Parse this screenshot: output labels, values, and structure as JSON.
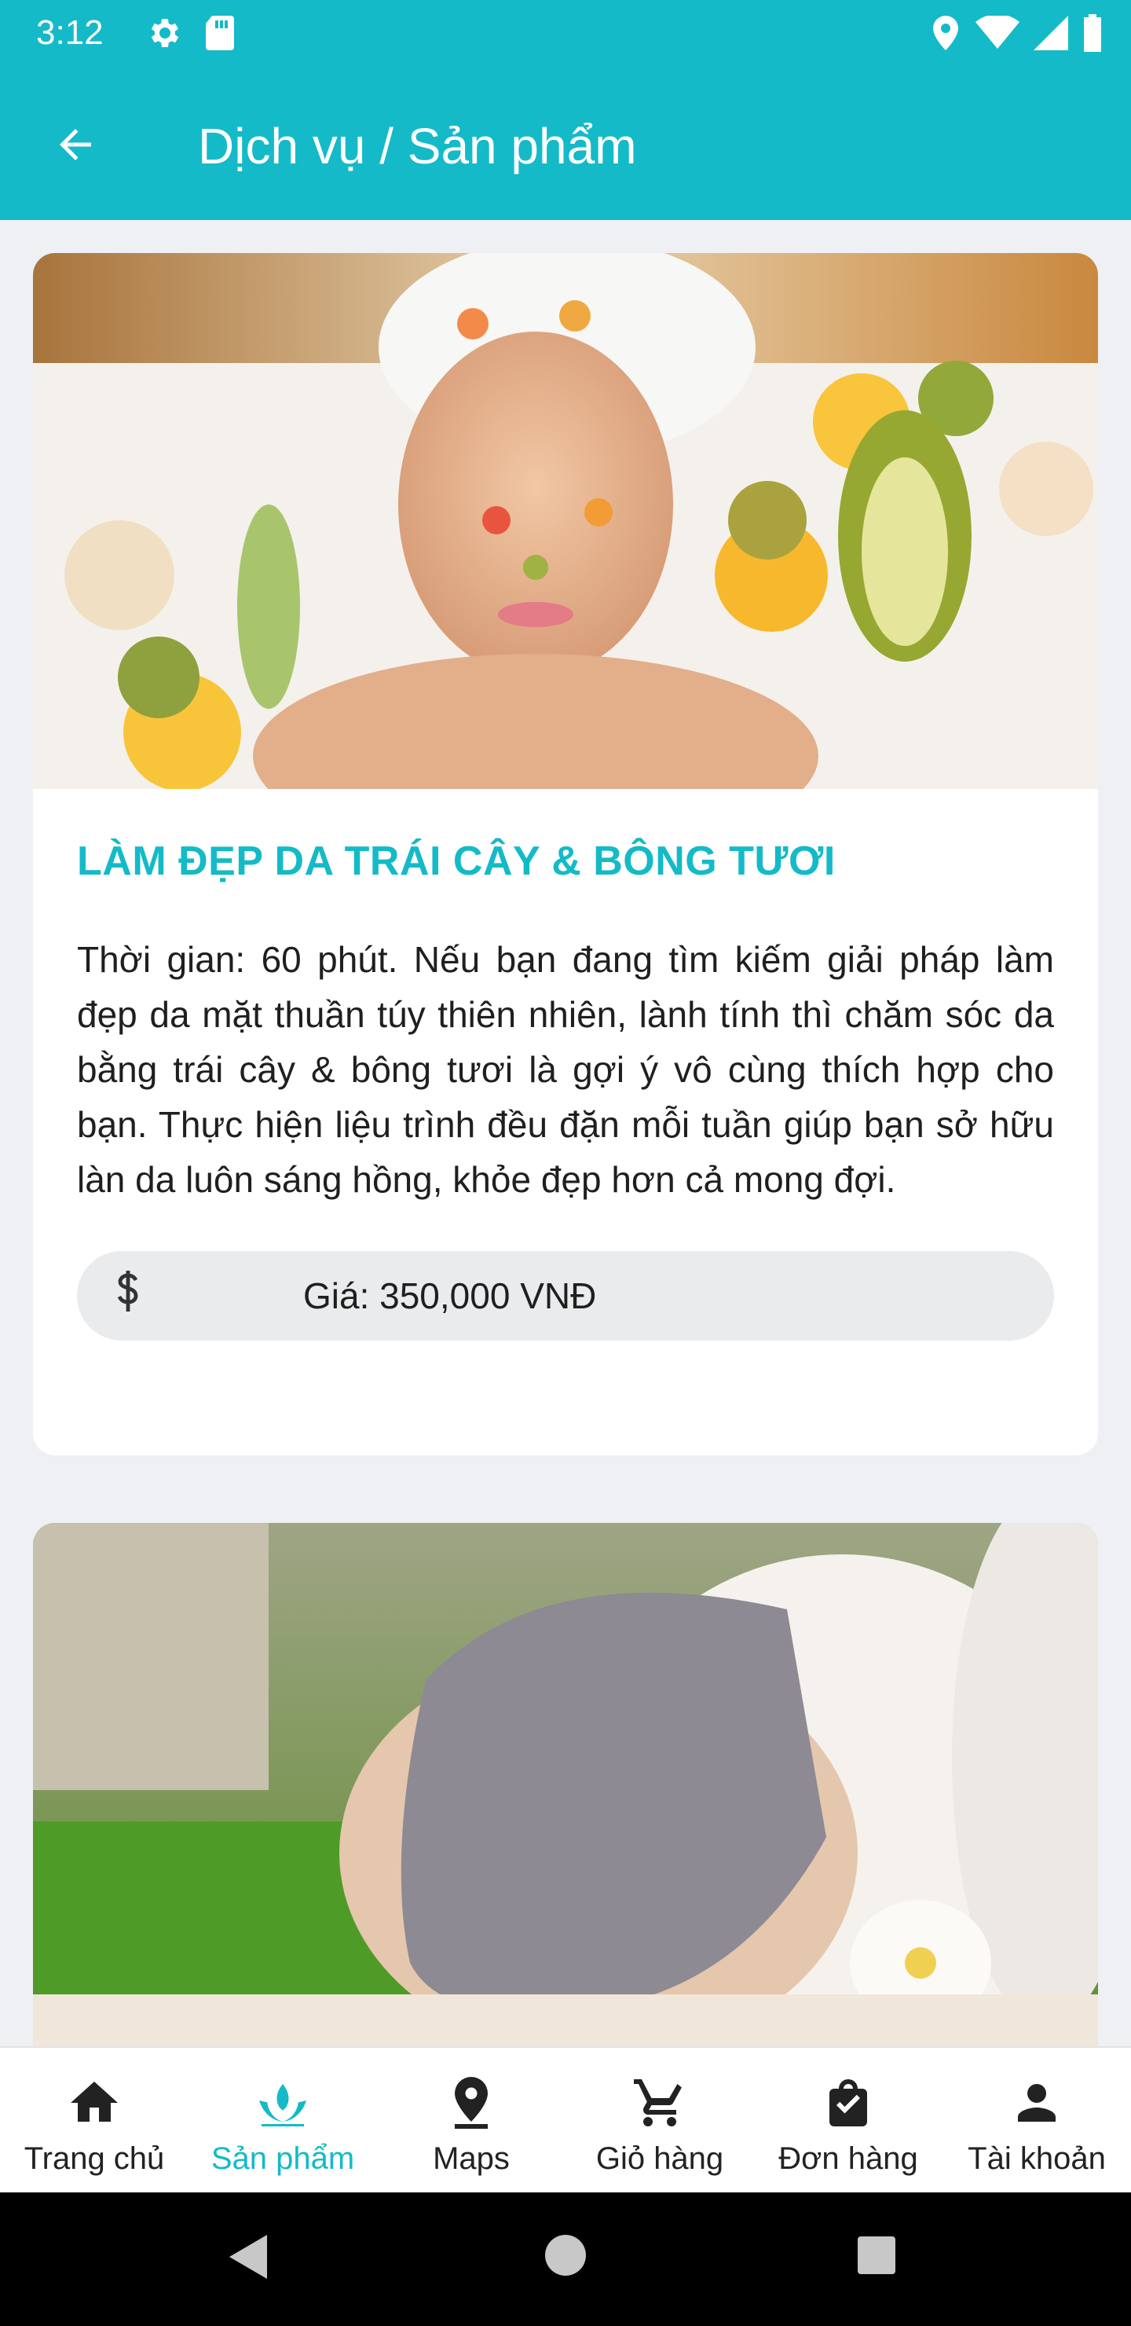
{
  "status_bar": {
    "time": "3:12",
    "left_icons": [
      "gear-icon",
      "sd-card-icon"
    ],
    "right_icons": [
      "location-icon",
      "wifi-icon",
      "signal-icon",
      "battery-icon"
    ]
  },
  "app_bar": {
    "title": "Dịch vụ / Sản phẩm",
    "back_icon": "arrow-left-icon"
  },
  "colors": {
    "primary": "#14bac8",
    "background": "#eef0f3",
    "price_pill": "#e9ebec"
  },
  "products": [
    {
      "title": "LÀM ĐẸP DA TRÁI CÂY & BÔNG TƯƠI",
      "description": "Thời gian: 60 phút. Nếu bạn đang tìm kiếm giải pháp làm đẹp da mặt thuần túy thiên nhiên, lành tính thì chăm sóc da bằng trái cây & bông tươi là gợi ý vô cùng thích hợp cho bạn. Thực hiện liệu trình đều đặn mỗi tuần giúp bạn sở hữu làn da luôn sáng hồng, khỏe đẹp hơn cả mong đợi.",
      "price_icon": "dollar-icon",
      "price": "Giá: 350,000 VNĐ"
    },
    {}
  ],
  "bottom_nav": [
    {
      "label": "Trang chủ",
      "icon": "home-icon",
      "active": false
    },
    {
      "label": "Sản phẩm",
      "icon": "lotus-icon",
      "active": true
    },
    {
      "label": "Maps",
      "icon": "map-pin-icon",
      "active": false
    },
    {
      "label": "Giỏ hàng",
      "icon": "cart-icon",
      "active": false
    },
    {
      "label": "Đơn hàng",
      "icon": "shopping-bag-icon",
      "active": false
    },
    {
      "label": "Tài khoản",
      "icon": "person-icon",
      "active": false
    }
  ],
  "system_nav": [
    "back-triangle-icon",
    "home-circle-icon",
    "recents-square-icon"
  ]
}
